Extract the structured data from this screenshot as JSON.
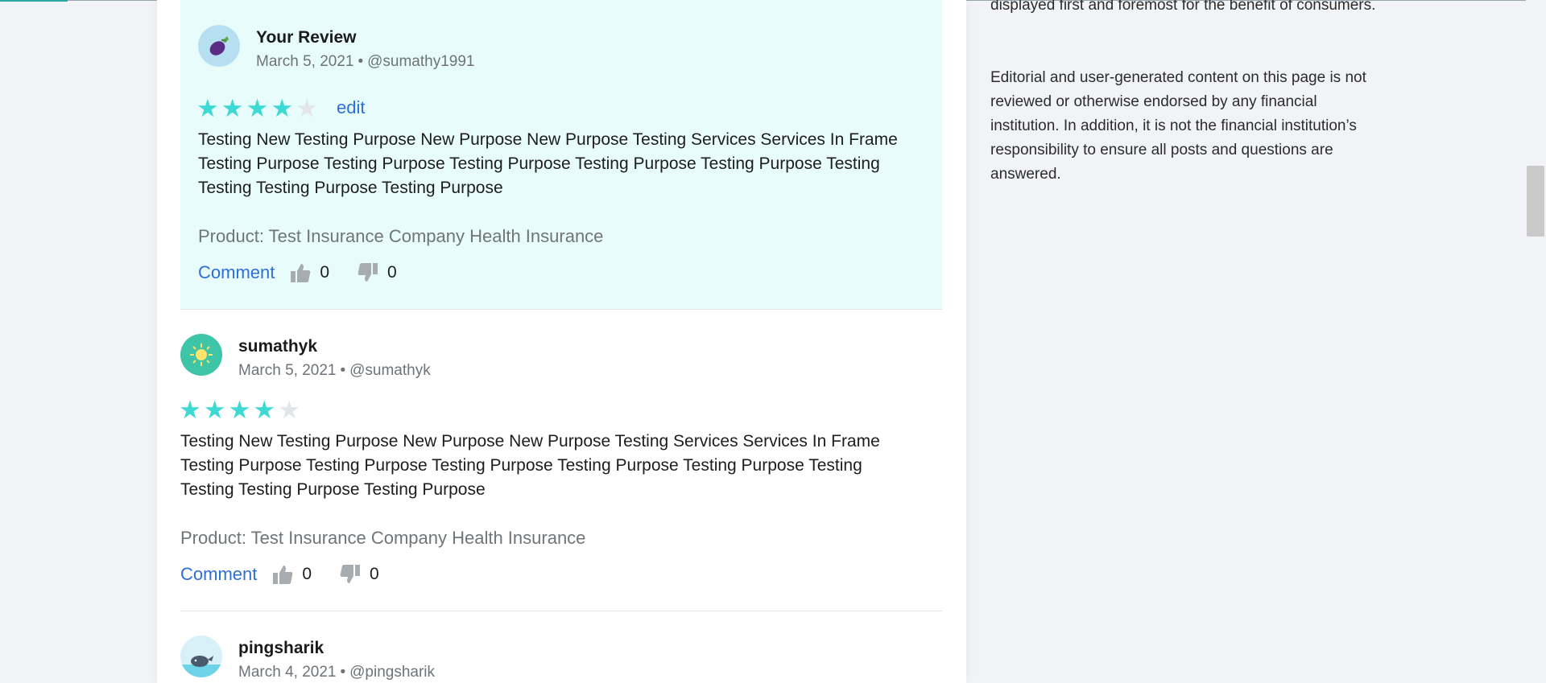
{
  "disclaimer": {
    "paragraph1_tail": "displayed first and foremost for the benefit of consumers.",
    "paragraph2": "Editorial and user-generated content on this page is not reviewed or otherwise endorsed by any financial institution. In addition, it is not the financial institution’s responsibility to ensure all posts and questions are answered."
  },
  "reviews": [
    {
      "name": "Your Review",
      "date": "March 5, 2021",
      "separator": "•",
      "handle": "@sumathy1991",
      "rating": 4,
      "rating_max": 5,
      "edit_label": "edit",
      "text": "Testing New Testing Purpose New Purpose New Purpose Testing Services Services In Frame Testing Purpose Testing Purpose Testing Purpose Testing Purpose Testing Purpose Testing Testing Testing Purpose Testing Purpose",
      "product": "Product: Test Insurance Company Health Insurance",
      "comment_label": "Comment",
      "likes": "0",
      "dislikes": "0",
      "avatar_icon": "eggplant-icon"
    },
    {
      "name": "sumathyk",
      "date": "March 5, 2021",
      "separator": "•",
      "handle": "@sumathyk",
      "rating": 4,
      "rating_max": 5,
      "text": "Testing New Testing Purpose New Purpose New Purpose Testing Services Services In Frame Testing Purpose Testing Purpose Testing Purpose Testing Purpose Testing Purpose Testing Testing Testing Purpose Testing Purpose",
      "product": "Product: Test Insurance Company Health Insurance",
      "comment_label": "Comment",
      "likes": "0",
      "dislikes": "0",
      "avatar_icon": "sun-icon"
    },
    {
      "name": "pingsharik",
      "date": "March 4, 2021",
      "separator": "•",
      "handle": "@pingsharik",
      "avatar_icon": "whale-icon"
    }
  ],
  "colors": {
    "page_bg": "#f1f3f6",
    "own_review_bg": "#e9fcfc",
    "star_filled": "#3fd9d4",
    "star_empty": "#e3e6e8",
    "link": "#2d6fd6"
  }
}
